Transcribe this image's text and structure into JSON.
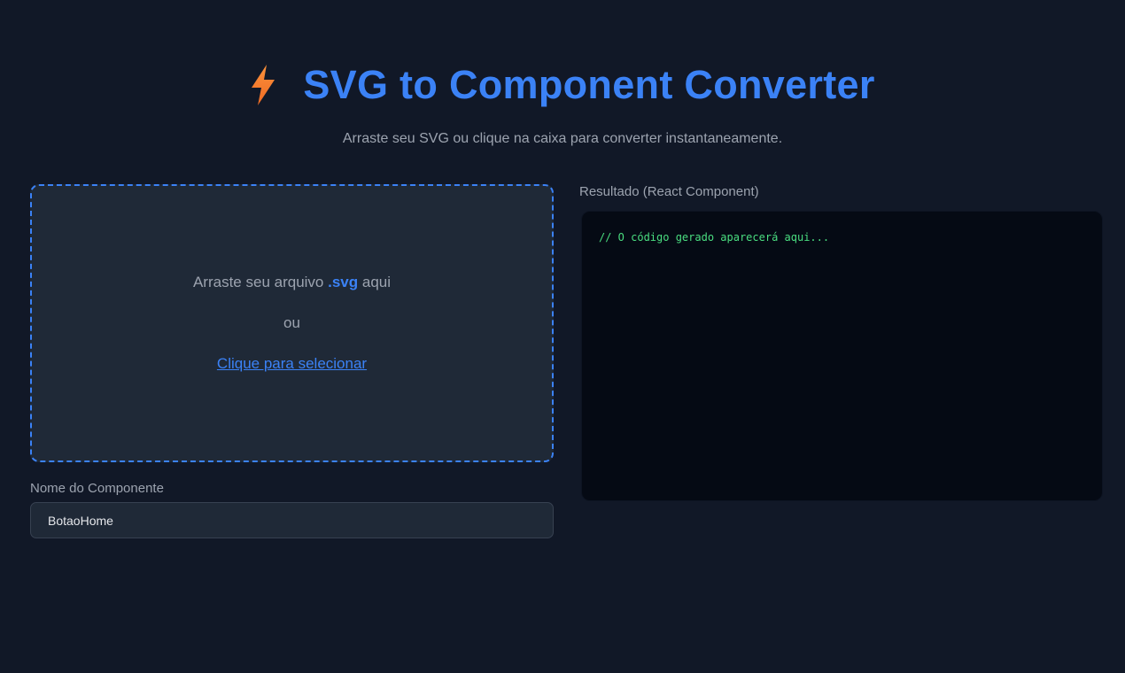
{
  "app": {
    "title": "SVG to Component Converter",
    "subtitle": "Arraste seu SVG ou clique na caixa para converter instantaneamente.",
    "title_icon": "lightning-bolt-icon"
  },
  "dropzone": {
    "prompt_prefix": "Arraste seu arquivo ",
    "prompt_ext": ".svg",
    "prompt_suffix": " aqui",
    "or_text": "ou",
    "select_link": "Clique para selecionar"
  },
  "component_name": {
    "label": "Nome do Componente",
    "value": "BotaoHome"
  },
  "result": {
    "label": "Resultado (React Component)",
    "code": "// O código gerado aparecerá aqui..."
  },
  "colors": {
    "background": "#111827",
    "panel": "#1f2937",
    "accent": "#3b82f6",
    "code_bg": "#050a14",
    "code_text": "#4ade80",
    "icon_top": "#f97316",
    "icon_bottom": "#facc15"
  }
}
